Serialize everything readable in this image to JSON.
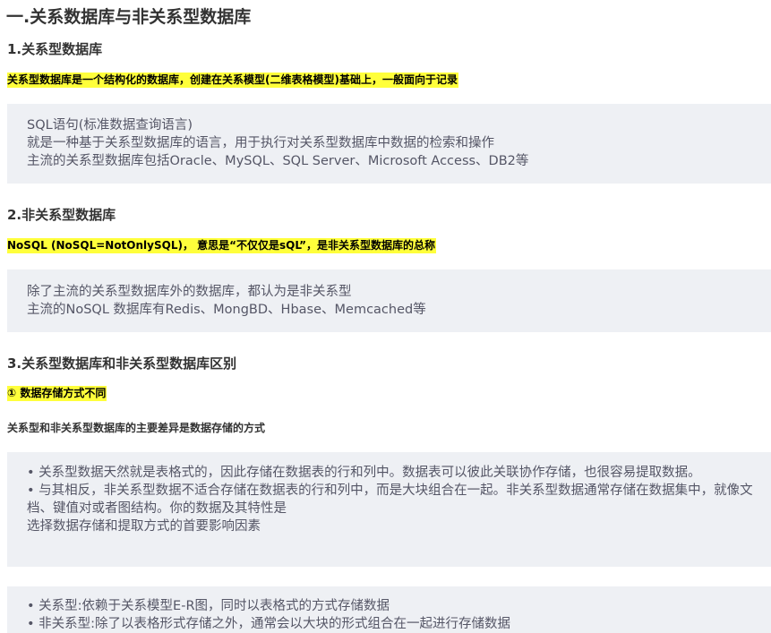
{
  "heading_main": "一.关系数据库与非关系型数据库",
  "section1": {
    "title": "1.关系型数据库",
    "highlight": "关系型数据库是一个结构化的数据库，创建在关系模型(二维表格模型)基础上，一般面向于记录",
    "quote_lines": [
      "SQL语句(标准数据查询语言)",
      "就是一种基于关系型数据库的语言，用于执行对关系型数据库中数据的检索和操作",
      "主流的关系型数据库包括Oracle、MySQL、SQL Server、Microsoft Access、DB2等"
    ]
  },
  "section2": {
    "title": "2.非关系型数据库",
    "highlight": "NoSQL (NoSQL=NotOnlySQL)， 意思是“不仅仅是sQL”，是非关系型数据库的总称",
    "quote_lines": [
      "除了主流的关系型数据库外的数据库，都认为是非关系型",
      "主流的NoSQL 数据库有Redis、MongBD、Hbase、Memcached等"
    ]
  },
  "section3": {
    "title": "3.关系型数据库和非关系型数据库区别",
    "sub_highlight": "① 数据存储方式不同",
    "summary": "关系型和非关系型数据库的主要差异是数据存储的方式",
    "quote1_lines": [
      "• 关系型数据天然就是表格式的，因此存储在数据表的行和列中。数据表可以彼此关联协作存储，也很容易提取数据。",
      "• 与其相反，非关系型数据不适合存储在数据表的行和列中，而是大块组合在一起。非关系型数据通常存储在数据集中，就像文档、键值对或者图结构。你的数据及其特性是",
      "选择数据存储和提取方式的首要影响因素"
    ],
    "quote2_lines": [
      "• 关系型:依赖于关系模型E-R图，同时以表格式的方式存储数据",
      "• 非关系型:除了以表格形式存储之外，通常会以大块的形式组合在一起进行存储数据"
    ]
  },
  "colors": {
    "highlight": "#ffff3b",
    "quote_background": "#eef0f4",
    "heading_text": "#333333",
    "quote_text": "#555666"
  }
}
